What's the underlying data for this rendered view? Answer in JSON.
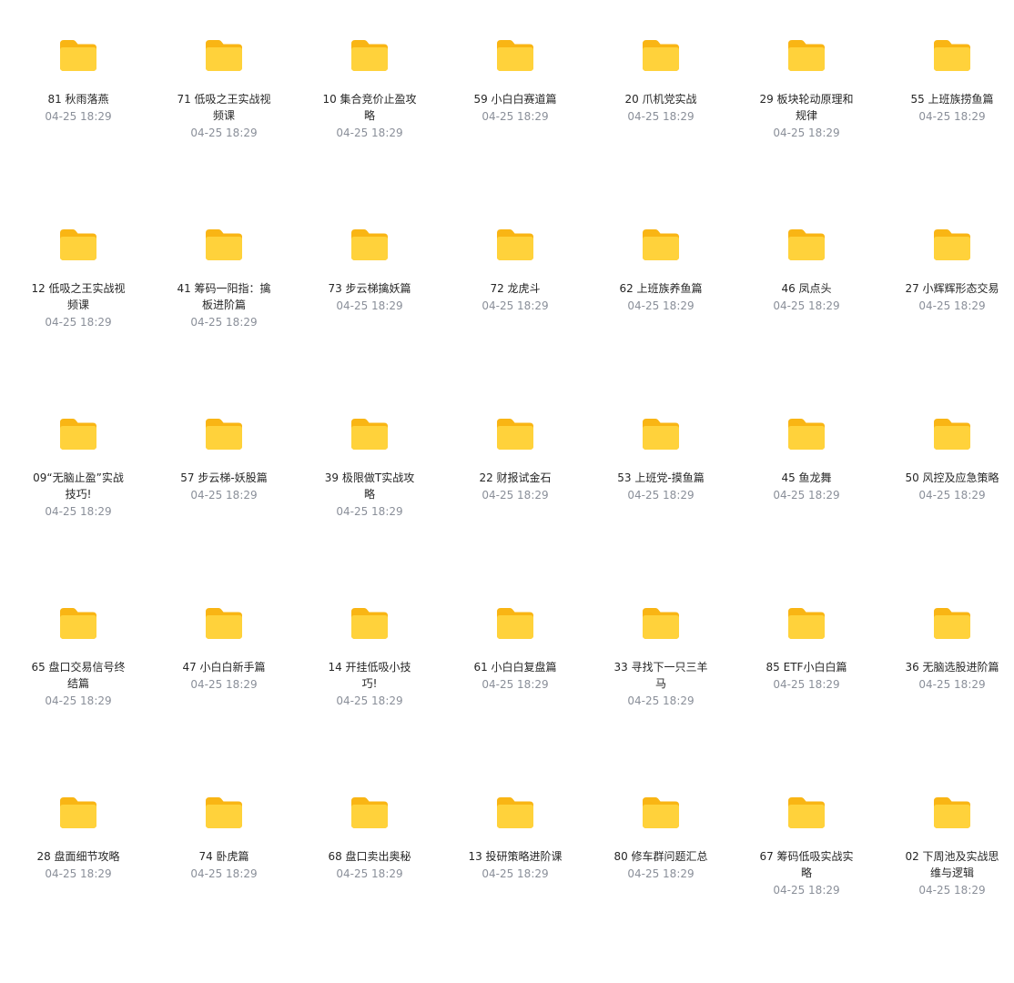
{
  "colors": {
    "folder_back": "#f9b514",
    "folder_front": "#ffd23b",
    "name_text": "#262626",
    "date_text": "#8a8f99"
  },
  "folders": [
    {
      "name": "81 秋雨落燕",
      "date": "04-25 18:29"
    },
    {
      "name": "71 低吸之王实战视频课",
      "date": "04-25 18:29"
    },
    {
      "name": "10 集合竞价止盈攻略",
      "date": "04-25 18:29"
    },
    {
      "name": "59 小白白赛道篇",
      "date": "04-25 18:29"
    },
    {
      "name": "20 爪机党实战",
      "date": "04-25 18:29"
    },
    {
      "name": "29 板块轮动原理和规律",
      "date": "04-25 18:29"
    },
    {
      "name": "55 上班族捞鱼篇",
      "date": "04-25 18:29"
    },
    {
      "name": "12 低吸之王实战视频课",
      "date": "04-25 18:29"
    },
    {
      "name": "41 筹码一阳指：擒板进阶篇",
      "date": "04-25 18:29"
    },
    {
      "name": "73 步云梯擒妖篇",
      "date": "04-25 18:29"
    },
    {
      "name": "72 龙虎斗",
      "date": "04-25 18:29"
    },
    {
      "name": "62 上班族养鱼篇",
      "date": "04-25 18:29"
    },
    {
      "name": "46 凤点头",
      "date": "04-25 18:29"
    },
    {
      "name": "27 小辉辉形态交易",
      "date": "04-25 18:29"
    },
    {
      "name": "09“无脑止盈”实战技巧!",
      "date": "04-25 18:29"
    },
    {
      "name": "57 步云梯-妖股篇",
      "date": "04-25 18:29"
    },
    {
      "name": "39 极限做T实战攻略",
      "date": "04-25 18:29"
    },
    {
      "name": "22 财报试金石",
      "date": "04-25 18:29"
    },
    {
      "name": "53 上班党-摸鱼篇",
      "date": "04-25 18:29"
    },
    {
      "name": "45 鱼龙舞",
      "date": "04-25 18:29"
    },
    {
      "name": "50 风控及应急策略",
      "date": "04-25 18:29"
    },
    {
      "name": "65 盘口交易信号终结篇",
      "date": "04-25 18:29"
    },
    {
      "name": "47 小白白新手篇",
      "date": "04-25 18:29"
    },
    {
      "name": "14 开挂低吸小技巧!",
      "date": "04-25 18:29"
    },
    {
      "name": "61 小白白复盘篇",
      "date": "04-25 18:29"
    },
    {
      "name": "33 寻找下一只三羊马",
      "date": "04-25 18:29"
    },
    {
      "name": "85 ETF小白白篇",
      "date": "04-25 18:29"
    },
    {
      "name": "36 无脑选股进阶篇",
      "date": "04-25 18:29"
    },
    {
      "name": "28 盘面细节攻略",
      "date": "04-25 18:29"
    },
    {
      "name": "74 卧虎篇",
      "date": "04-25 18:29"
    },
    {
      "name": "68 盘口卖出奥秘",
      "date": "04-25 18:29"
    },
    {
      "name": "13 投研策略进阶课",
      "date": "04-25 18:29"
    },
    {
      "name": "80 修车群问题汇总",
      "date": "04-25 18:29"
    },
    {
      "name": "67 筹码低吸实战实略",
      "date": "04-25 18:29"
    },
    {
      "name": "02 下周池及实战思维与逻辑",
      "date": "04-25 18:29"
    }
  ]
}
